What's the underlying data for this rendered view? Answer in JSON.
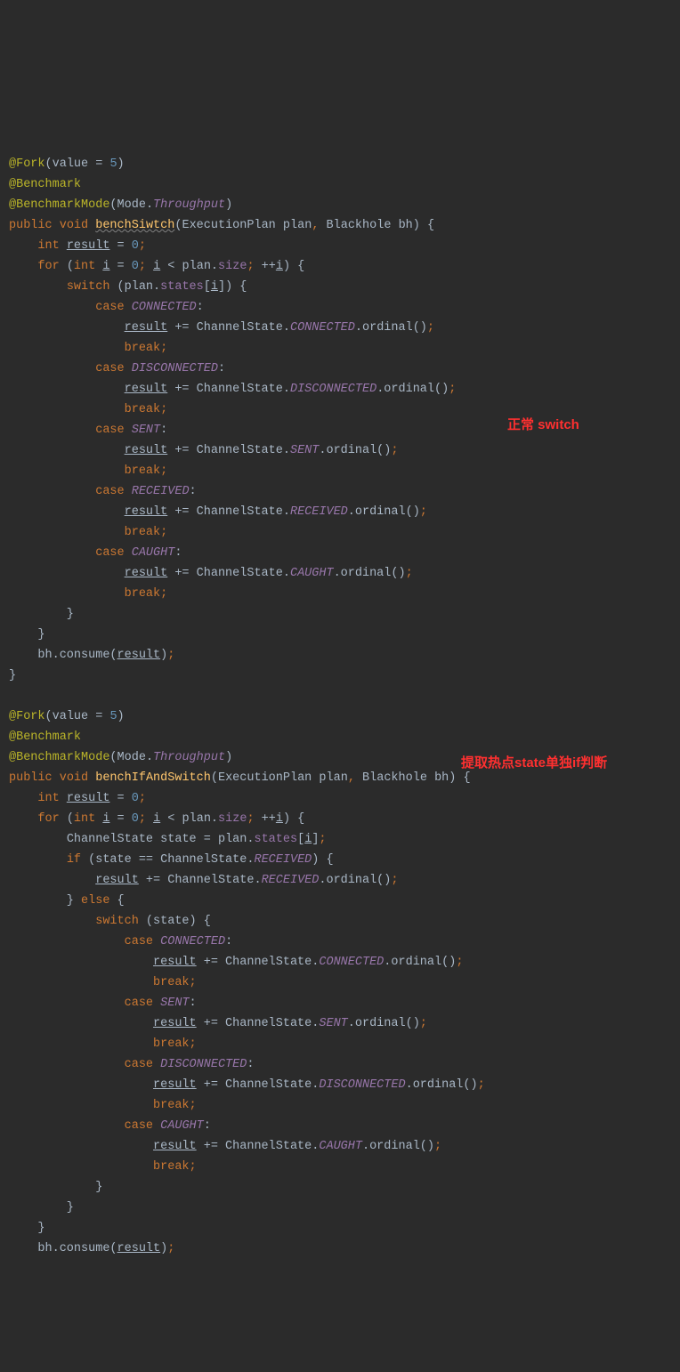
{
  "annotations": {
    "fork": "@Fork",
    "forkParam": "value = ",
    "forkVal": "5",
    "benchmark": "@Benchmark",
    "benchmarkMode": "@BenchmarkMode",
    "modeType": "Mode",
    "throughput": "Throughput"
  },
  "method1": {
    "signature": {
      "public": "public",
      "void": "void",
      "name": "benchSiwtch",
      "p1type": "ExecutionPlan",
      "p1name": "plan",
      "p2type": "Blackhole",
      "p2name": "bh"
    },
    "body": {
      "int": "int",
      "result": "result",
      "zero": "0",
      "for": "for",
      "i": "i",
      "plan": "plan",
      "size": "size",
      "states": "states",
      "switch": "switch",
      "case": "case",
      "CONNECTED": "CONNECTED",
      "DISCONNECTED": "DISCONNECTED",
      "SENT": "SENT",
      "RECEIVED": "RECEIVED",
      "CAUGHT": "CAUGHT",
      "ChannelState": "ChannelState",
      "ordinal": "ordinal",
      "break": "break",
      "bh": "bh",
      "consume": "consume"
    },
    "comment": "正常 switch"
  },
  "method2": {
    "signature": {
      "public": "public",
      "void": "void",
      "name": "benchIfAndSwitch",
      "p1type": "ExecutionPlan",
      "p1name": "plan",
      "p2type": "Blackhole",
      "p2name": "bh"
    },
    "body": {
      "int": "int",
      "result": "result",
      "zero": "0",
      "for": "for",
      "i": "i",
      "plan": "plan",
      "size": "size",
      "states": "states",
      "ChannelState": "ChannelState",
      "state": "state",
      "if": "if",
      "else": "else",
      "RECEIVED": "RECEIVED",
      "ordinal": "ordinal",
      "switch": "switch",
      "case": "case",
      "CONNECTED": "CONNECTED",
      "SENT": "SENT",
      "DISCONNECTED": "DISCONNECTED",
      "CAUGHT": "CAUGHT",
      "break": "break",
      "bh": "bh",
      "consume": "consume"
    },
    "comment": "提取热点state单独if判断"
  }
}
